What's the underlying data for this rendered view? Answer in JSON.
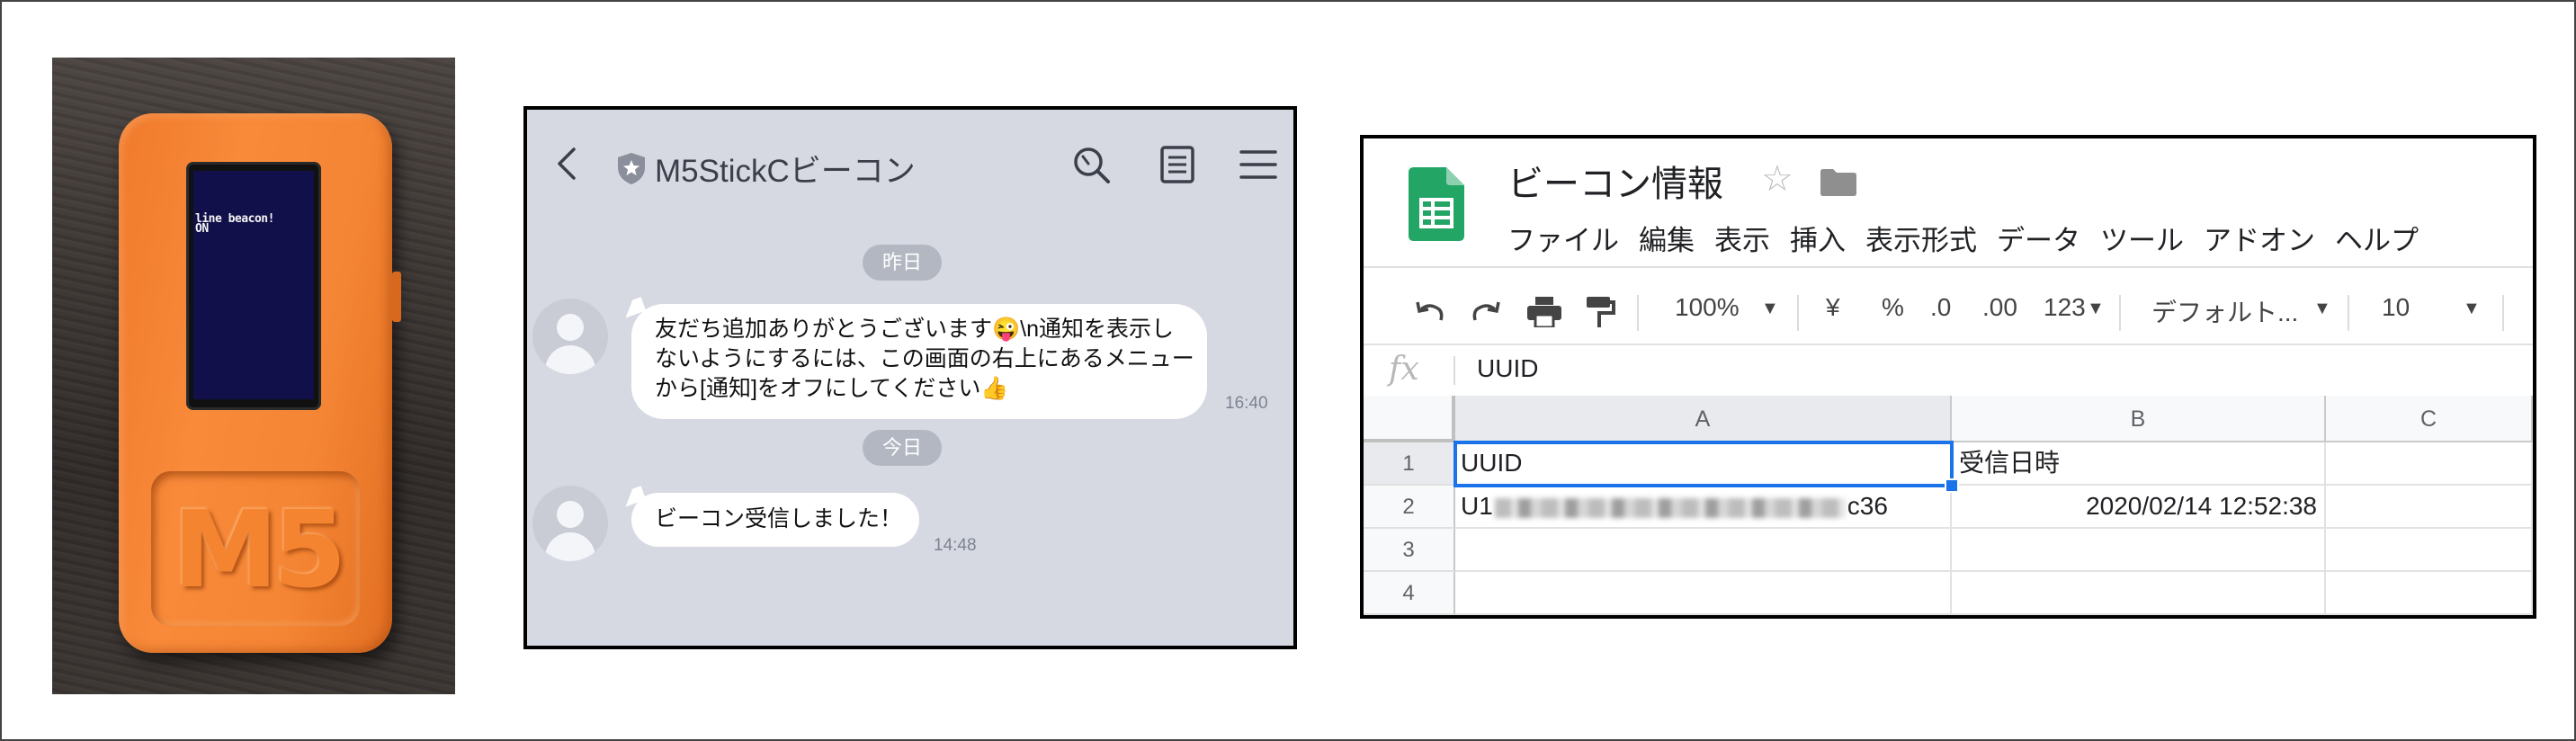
{
  "device": {
    "screen_text": "line beacon!\nON",
    "logo_text": "M5"
  },
  "chat": {
    "title": "M5StickCビーコン",
    "messages": [
      {
        "date": "昨日",
        "text_lines": [
          "友だち追加ありがとうございます😜\\n通知を表示し",
          "ないようにするには、この画面の右上にあるメニュー",
          "から[通知]をオフにしてください👍"
        ],
        "time": "16:40"
      },
      {
        "date": "今日",
        "text_lines": [
          "ビーコン受信しました！"
        ],
        "time": "14:48"
      }
    ]
  },
  "sheet": {
    "title": "ビーコン情報",
    "menu": [
      "ファイル",
      "編集",
      "表示",
      "挿入",
      "表示形式",
      "データ",
      "ツール",
      "アドオン",
      "ヘルプ"
    ],
    "toolbar": {
      "zoom": "100%",
      "currency": "¥",
      "percent": "%",
      "dec_decrease": ".0",
      "dec_increase": ".00",
      "more_formats": "123",
      "font": "デフォルト...",
      "font_size": "10"
    },
    "formula_value": "UUID",
    "columns": [
      "A",
      "B",
      "C"
    ],
    "rows": [
      {
        "num": "1",
        "a": "UUID",
        "b": "受信日時",
        "c": ""
      },
      {
        "num": "2",
        "a_prefix": "U1",
        "a_suffix": "c36",
        "b": "2020/02/14 12:52:38",
        "c": ""
      },
      {
        "num": "3",
        "a": "",
        "b": "",
        "c": ""
      },
      {
        "num": "4",
        "a": "",
        "b": "",
        "c": ""
      }
    ]
  }
}
